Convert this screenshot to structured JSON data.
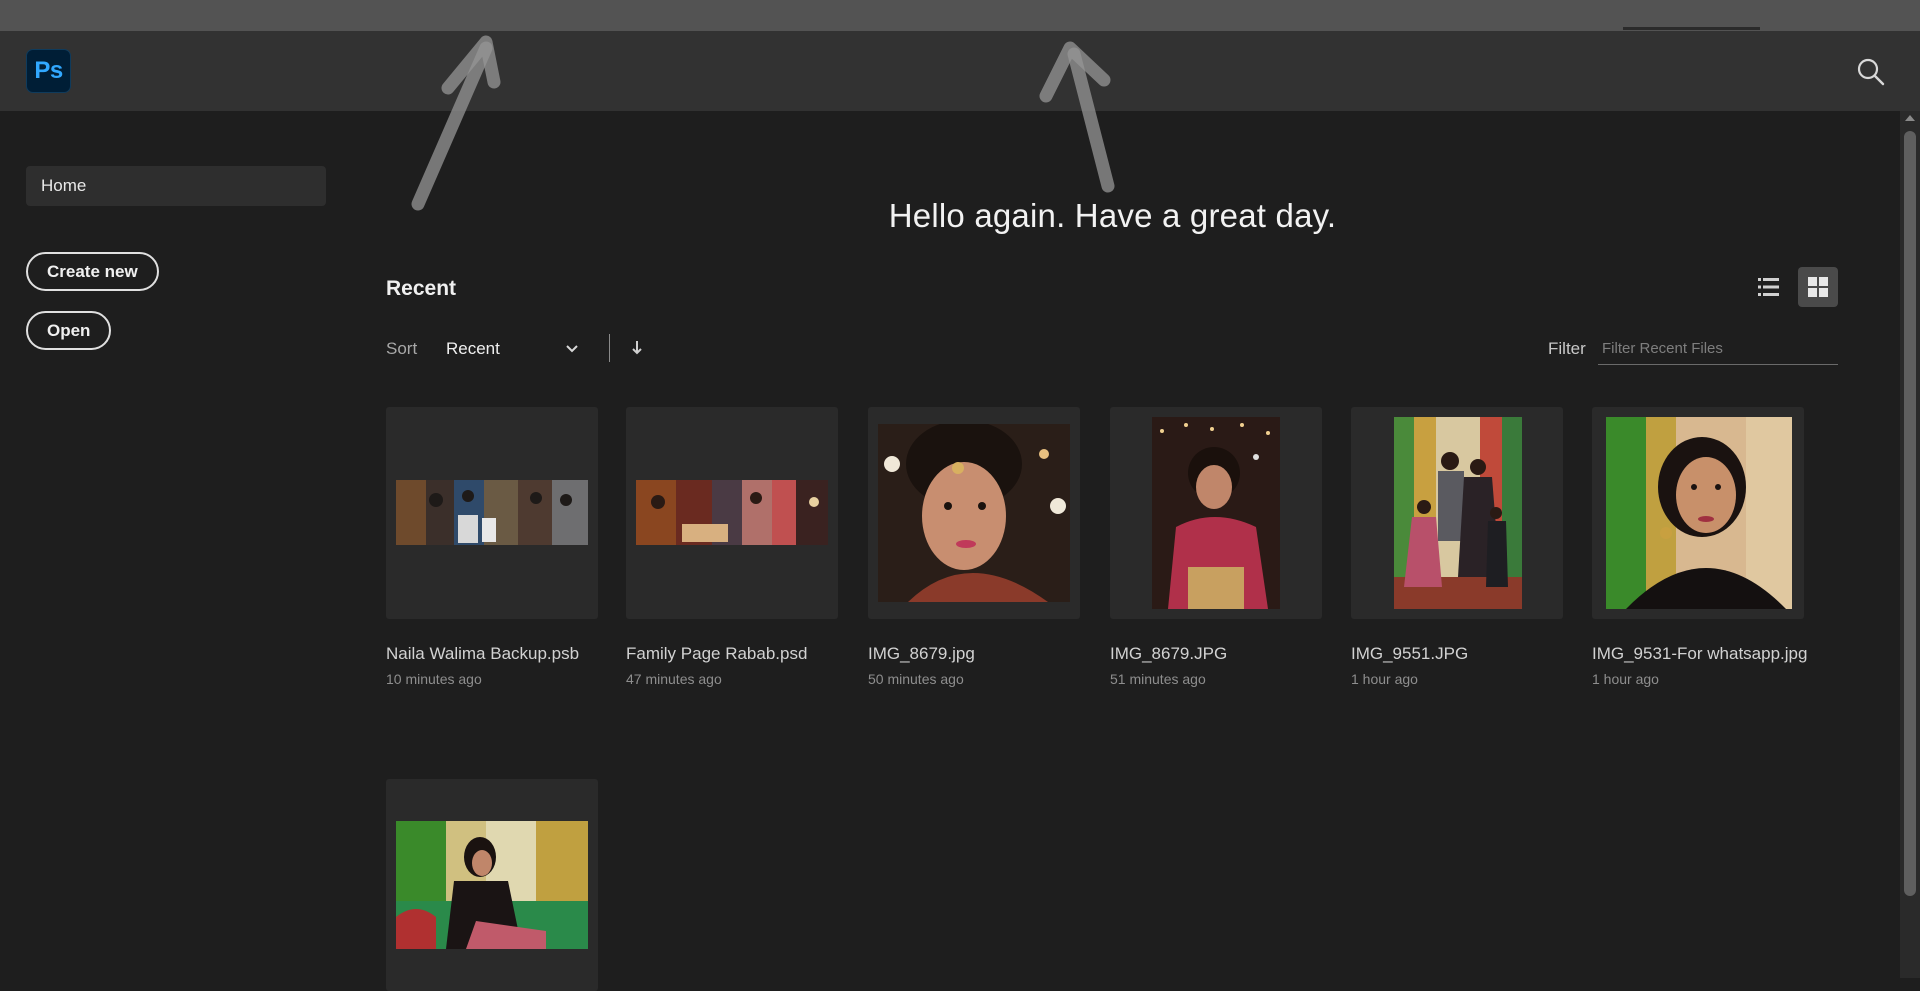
{
  "app": {
    "logo_text": "Ps",
    "brand_color": "#31a8ff",
    "search_icon": "search-icon"
  },
  "sidebar": {
    "home_label": "Home",
    "create_new_label": "Create new",
    "open_label": "Open"
  },
  "main": {
    "greeting": "Hello again. Have a great day.",
    "recent_title": "Recent",
    "sort_label": "Sort",
    "sort_value": "Recent",
    "filter_label": "Filter",
    "filter_placeholder": "Filter Recent Files",
    "view_mode": "grid"
  },
  "recent_files": [
    {
      "name": "Naila Walima Backup.psb",
      "time": "10 minutes ago",
      "thumb": "panorama"
    },
    {
      "name": "Family Page Rabab.psd",
      "time": "47 minutes ago",
      "thumb": "panorama"
    },
    {
      "name": "IMG_8679.jpg",
      "time": "50 minutes ago",
      "thumb": "portrait-square"
    },
    {
      "name": "IMG_8679.JPG",
      "time": "51 minutes ago",
      "thumb": "portrait-tall"
    },
    {
      "name": "IMG_9551.JPG",
      "time": "1 hour ago",
      "thumb": "group-tall"
    },
    {
      "name": "IMG_9531-For whatsapp.jpg",
      "time": "1 hour ago",
      "thumb": "portrait-square"
    },
    {
      "name": "",
      "time": "",
      "thumb": "landscape"
    }
  ]
}
